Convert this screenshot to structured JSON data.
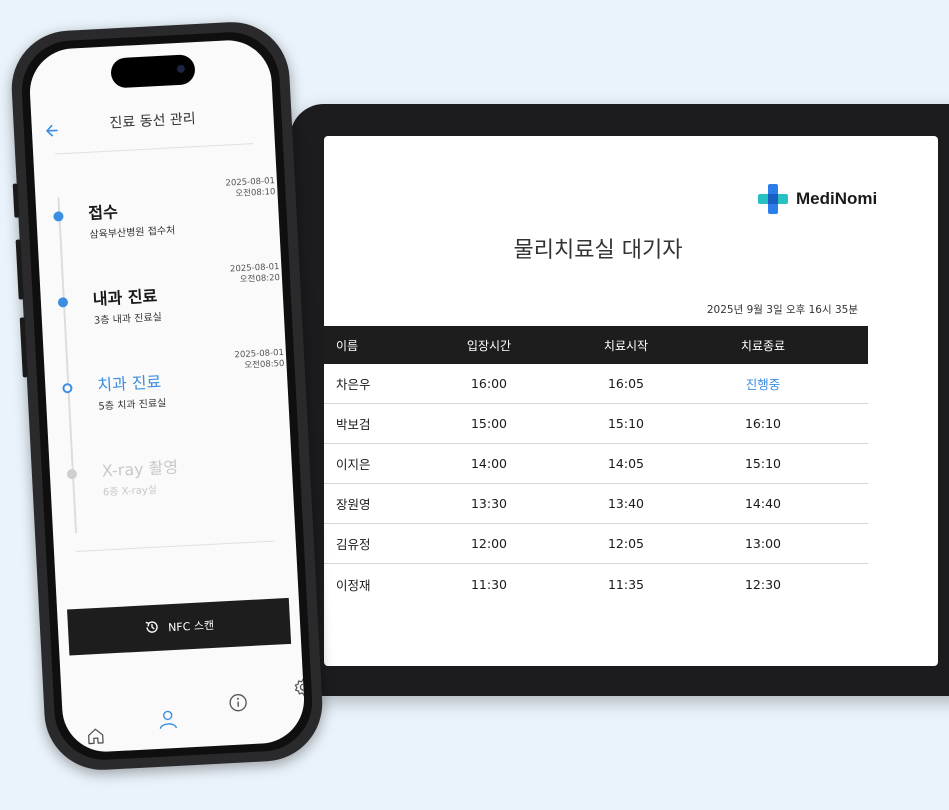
{
  "tablet": {
    "brand": "MediNomi",
    "title": "물리치료실 대기자",
    "datetime": "2025년 9월 3일   오후 16시 35분",
    "columns": [
      "이름",
      "입장시간",
      "치료시작",
      "치료종료"
    ],
    "rows": [
      {
        "name": "차은우",
        "enter": "16:00",
        "start": "16:05",
        "end": "진행중"
      },
      {
        "name": "박보검",
        "enter": "15:00",
        "start": "15:10",
        "end": "16:10"
      },
      {
        "name": "이지은",
        "enter": "14:00",
        "start": "14:05",
        "end": "15:10"
      },
      {
        "name": "장원영",
        "enter": "13:30",
        "start": "13:40",
        "end": "14:40"
      },
      {
        "name": "김유정",
        "enter": "12:00",
        "start": "12:05",
        "end": "13:00"
      },
      {
        "name": "이정재",
        "enter": "11:30",
        "start": "11:35",
        "end": "12:30"
      }
    ],
    "colors": {
      "header_bg": "#1d1d1d",
      "in_progress": "#3b8ee0",
      "logo_blue": "#2b7de9",
      "logo_teal": "#27c1c4"
    }
  },
  "phone": {
    "back_icon": "arrow-left-icon",
    "title": "진료 동선 관리",
    "steps": [
      {
        "title": "접수",
        "subtitle": "삼육부산병원 접수처",
        "date": "2025-08-01",
        "time": "오전08:10",
        "state": "done"
      },
      {
        "title": "내과 진료",
        "subtitle": "3층 내과 진료실",
        "date": "2025-08-01",
        "time": "오전08:20",
        "state": "done"
      },
      {
        "title": "치과 진료",
        "subtitle": "5층 치과 진료실",
        "date": "2025-08-01",
        "time": "오전08:50",
        "state": "current"
      },
      {
        "title": "X-ray 촬영",
        "subtitle": "6층 X-ray실",
        "date": "",
        "time": "",
        "state": "pending"
      }
    ],
    "nfc_label": "NFC 스캔",
    "nav": [
      "home-icon",
      "user-icon",
      "info-icon",
      "settings-icon"
    ],
    "colors": {
      "accent": "#3b8ee0"
    }
  }
}
